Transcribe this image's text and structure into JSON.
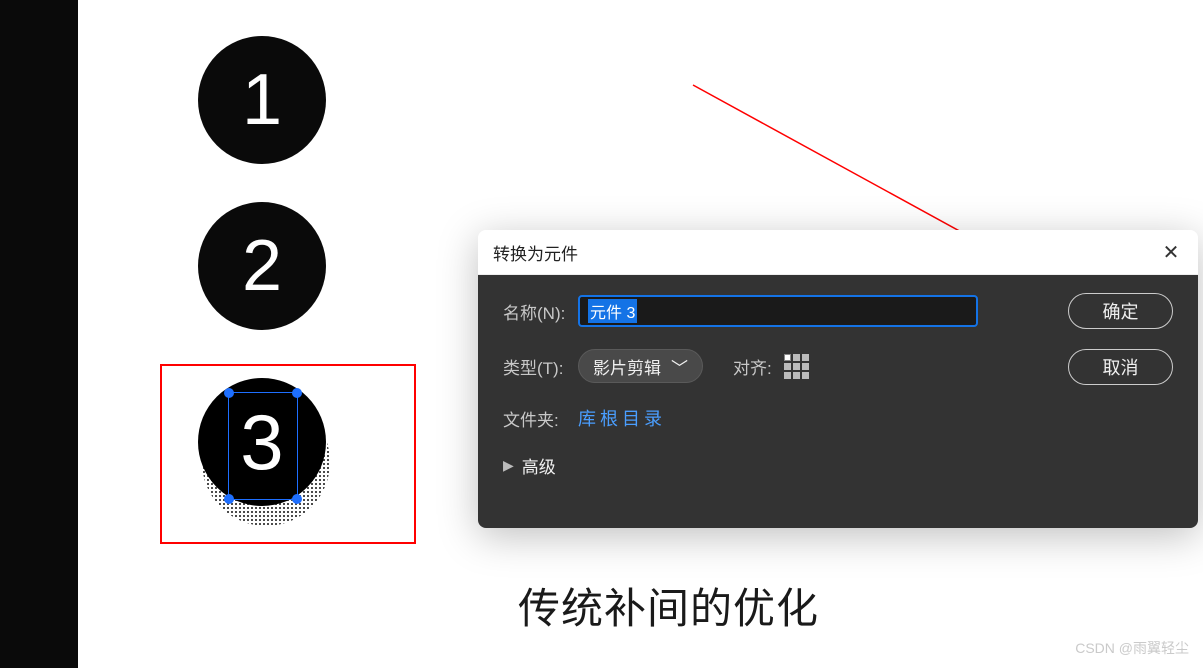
{
  "circles": {
    "one": "1",
    "two": "2",
    "three": "3"
  },
  "dialog": {
    "title": "转换为元件",
    "name_label": "名称(N):",
    "name_value": "元件 3",
    "type_label": "类型(T):",
    "type_value": "影片剪辑",
    "align_label": "对齐:",
    "folder_label": "文件夹:",
    "folder_value": "库根目录",
    "advanced_label": "高级",
    "ok_button": "确定",
    "cancel_button": "取消"
  },
  "caption": "传统补间的优化",
  "watermark": "CSDN @雨翼轻尘"
}
